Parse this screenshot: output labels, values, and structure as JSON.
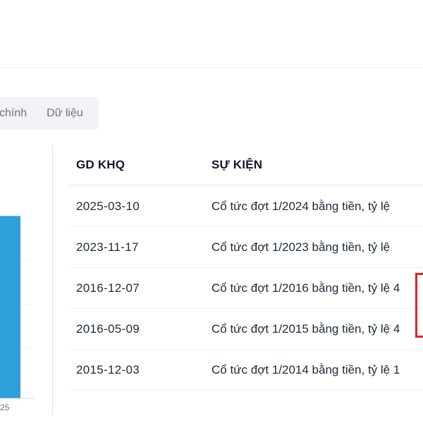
{
  "tabs": {
    "items": [
      {
        "label": "chính"
      },
      {
        "label": "Dữ liệu"
      }
    ]
  },
  "chart": {
    "x_tick_label": "25"
  },
  "chart_data": {
    "type": "bar",
    "categories": [
      "25"
    ],
    "values": [
      1
    ],
    "title": "",
    "xlabel": "",
    "ylabel": "",
    "ylim": [
      0,
      1.1
    ],
    "bar_color": "#2e9fd9"
  },
  "table": {
    "headers": {
      "date": "GD KHQ",
      "event": "SỰ KIỆN"
    },
    "rows": [
      {
        "date": "2025-03-10",
        "event": "Cổ tức đợt 1/2024 bằng tiền, tỷ lệ"
      },
      {
        "date": "2023-11-17",
        "event": "Cổ tức đợt 1/2023 bằng tiền, tỷ lệ"
      },
      {
        "date": "2016-12-07",
        "event": "Cổ tức đợt 1/2016 bằng tiền, tỷ lệ 4"
      },
      {
        "date": "2016-05-09",
        "event": "Cổ tức đợt 1/2015 bằng tiền, tỷ lệ 4"
      },
      {
        "date": "2015-12-03",
        "event": "Cổ tức đợt 1/2014 bằng tiền, tỷ lệ 1"
      }
    ]
  },
  "colors": {
    "highlight": "#dc2626",
    "tab_background": "#f1f3f6"
  }
}
